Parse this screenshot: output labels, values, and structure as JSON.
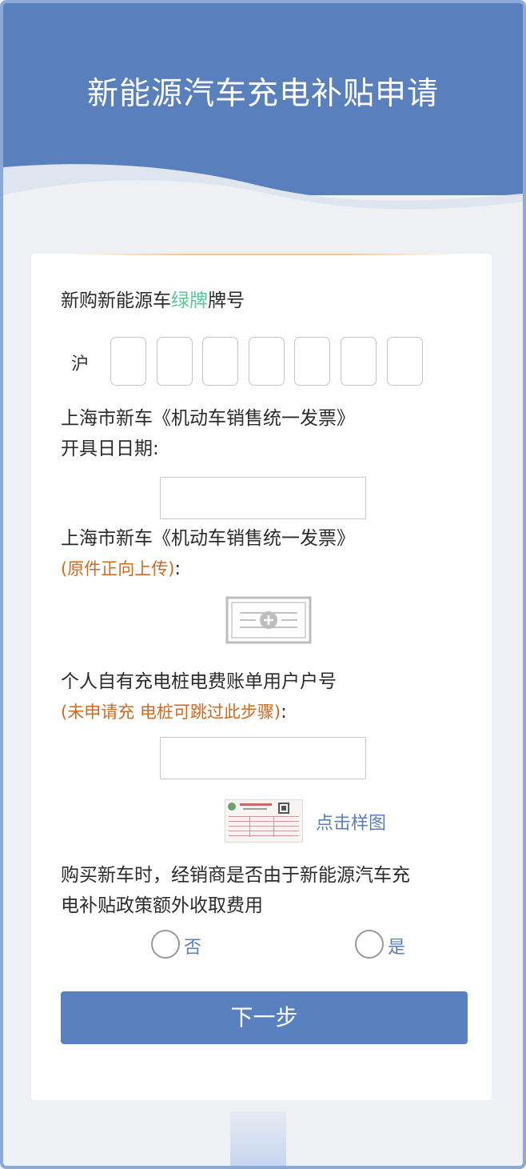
{
  "header": {
    "title": "新能源汽车充电补贴申请"
  },
  "colors": {
    "header_blue": "#5a7fbd",
    "button_blue": "#5a81bf",
    "accent_green": "#58c79a",
    "warning_orange": "#d2691e",
    "link_blue": "#5a7fb6"
  },
  "plate": {
    "label_before": "新购新能源车",
    "label_green": "绿牌",
    "label_after": "牌号",
    "prefix": "沪",
    "slots": [
      "",
      "",
      "",
      "",
      "",
      "",
      ""
    ]
  },
  "invoice_date": {
    "label_line1": "上海市新车《机动车销售统一发票》",
    "label_line2": "开具日日期:",
    "value": ""
  },
  "invoice_upload": {
    "label_line1": "上海市新车《机动车销售统一发票》",
    "note": "(原件正向上传)",
    "colon": ":",
    "icon": "upload-add-icon"
  },
  "charging_account": {
    "label_line1": "个人自有充电桩电费账单用户户号",
    "note": "(未申请充 电桩可跳过此步骤)",
    "colon": ":",
    "value": ""
  },
  "sample": {
    "link_text": "点击样图",
    "thumb_icon": "sample-bill-thumbnail"
  },
  "question": {
    "line1": "购买新车时，经销商是否由于新能源汽车充",
    "line2": "电补贴政策额外收取费用",
    "options": [
      "否",
      "是"
    ]
  },
  "next_button": {
    "label": "下一步"
  }
}
